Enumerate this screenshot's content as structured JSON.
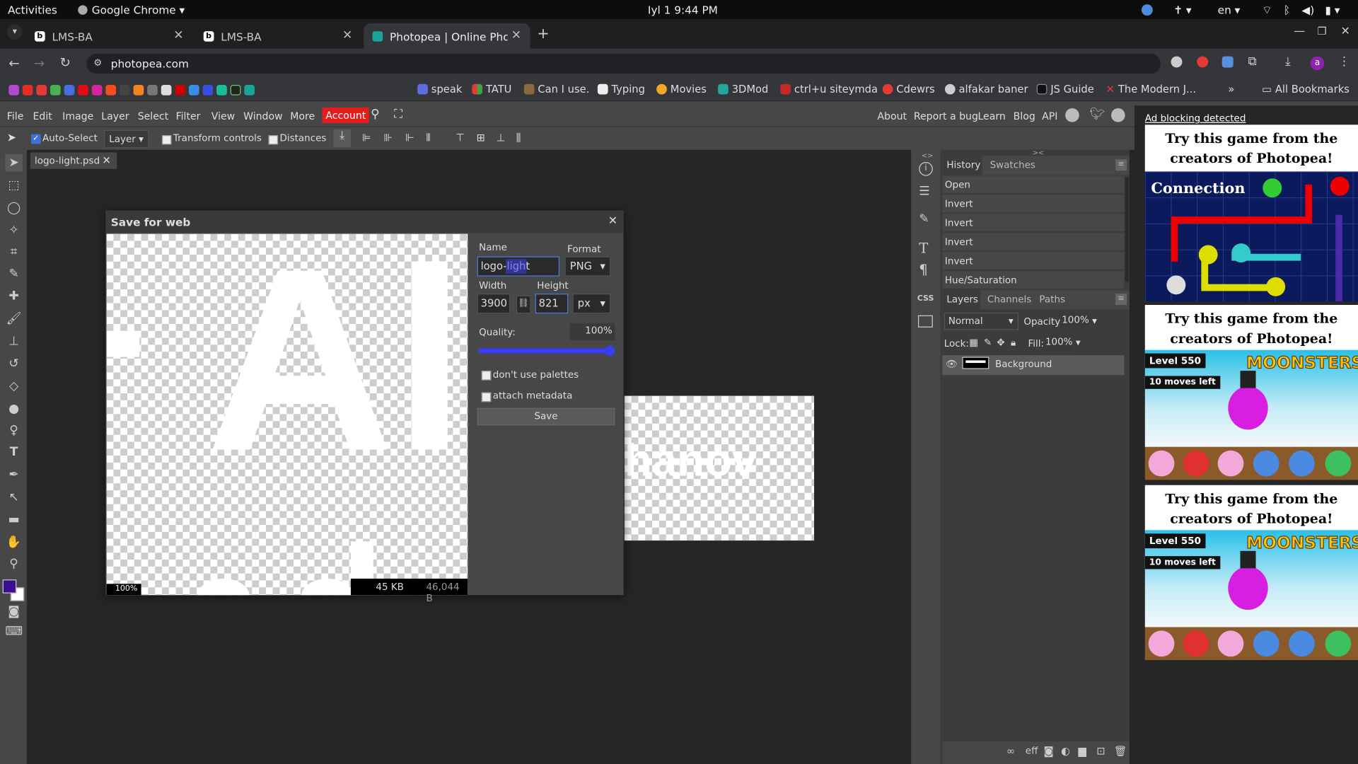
{
  "system": {
    "activities": "Activities",
    "app": "Google Chrome",
    "clock": "Iyl 1  9:44 PM",
    "lang": "en"
  },
  "browser": {
    "tabs": [
      {
        "title": "LMS-BA"
      },
      {
        "title": "LMS-BA"
      },
      {
        "title": "Photopea | Online Photo"
      }
    ],
    "url": "photopea.com",
    "profile_initial": "a",
    "bookmarks": [
      "speak",
      "TATU",
      "Can I use.",
      "Typing",
      "Movies",
      "3DMod",
      "ctrl+u siteymda",
      "Cdewrs",
      "alfakar baner",
      "JS Guide",
      "The Modern J...",
      "All Bookmarks"
    ]
  },
  "menu": {
    "items": [
      "File",
      "Edit",
      "Image",
      "Layer",
      "Select",
      "Filter",
      "View",
      "Window",
      "More"
    ],
    "account": "Account",
    "right": [
      "About",
      "Report a bug",
      "Learn",
      "Blog",
      "API"
    ],
    "ad_notice": "Ad blocking detected"
  },
  "options": {
    "auto_select": "Auto-Select",
    "layer_select": "Layer",
    "transform": "Transform controls",
    "distances": "Distances"
  },
  "document": {
    "tab_name": "logo-light.psd",
    "canvas_text": "hanov"
  },
  "dialog": {
    "title": "Save for web",
    "name_label": "Name",
    "name_value": "logo-light",
    "format_label": "Format",
    "format_value": "PNG",
    "width_label": "Width",
    "width_value": "3900",
    "height_label": "Height",
    "height_value": "821",
    "unit_value": "px",
    "quality_label": "Quality:",
    "quality_value": "100%",
    "quality_fraction": 1.0,
    "palettes": "don't use palettes",
    "metadata": "attach metadata",
    "save": "Save",
    "preview_text": "Al",
    "zoom": "100%",
    "size_kb": "45 KB",
    "size_bytes": "46,044 B"
  },
  "history": {
    "tabs": [
      "History",
      "Swatches"
    ],
    "items": [
      "Open",
      "Invert",
      "Invert",
      "Invert",
      "Invert",
      "Hue/Saturation"
    ]
  },
  "layers": {
    "tabs": [
      "Layers",
      "Channels",
      "Paths"
    ],
    "blend": "Normal",
    "opacity_label": "Opacity:",
    "opacity": "100%",
    "lock_label": "Lock:",
    "fill_label": "Fill:",
    "fill": "100%",
    "items": [
      {
        "name": "Background"
      }
    ]
  },
  "ads": {
    "headline": "Try this game from the creators of Photopea!",
    "game1": "Connection",
    "game2": "MOONSTERS",
    "level": "Level 550",
    "moves": "10 moves left"
  },
  "colors": {
    "accent": "#3c3cf0",
    "account": "#e51c1c",
    "primary_swatch": "#3a0e8c"
  }
}
